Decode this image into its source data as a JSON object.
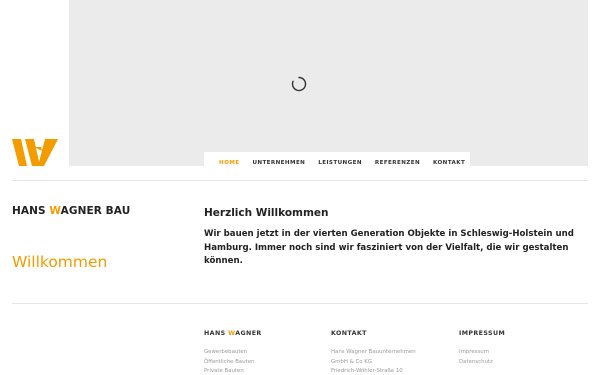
{
  "colors": {
    "accent": "#f39c00",
    "hero_bg": "#ebebeb",
    "text": "#222222",
    "muted": "#9a9a9a"
  },
  "logo": {
    "icon": "w-logo-icon"
  },
  "hero": {
    "icon": "loading-spinner-icon"
  },
  "nav": {
    "items": [
      {
        "label": "HOME",
        "active": true
      },
      {
        "label": "UNTERNEHMEN",
        "active": false
      },
      {
        "label": "LEISTUNGEN",
        "active": false
      },
      {
        "label": "REFERENZEN",
        "active": false
      },
      {
        "label": "KONTAKT",
        "active": false
      }
    ]
  },
  "brand": {
    "part1": "HANS ",
    "w": "W",
    "part2": "AGNER BAU"
  },
  "page_title": "Willkommen",
  "welcome": {
    "heading": "Herzlich Willkommen",
    "text": "Wir bauen jetzt in der vierten Generation Objekte in Schleswig-Holstein und Hamburg. Immer noch sind wir fasziniert von der Vielfalt, die wir gestalten können."
  },
  "footer": {
    "col1": {
      "heading_part1": "HANS ",
      "heading_w": "W",
      "heading_part2": "AGNER",
      "links": [
        "Gewerbebauten",
        "Öffentliche Bauten",
        "Private Bauten"
      ]
    },
    "col2": {
      "heading": "KONTAKT",
      "lines": [
        "Hans Wagner Bauunternehmen",
        "GmbH & Co KG",
        "Friedrich-Wöhler-Straße 10"
      ]
    },
    "col3": {
      "heading": "IMPRESSUM",
      "links": [
        "Impressum",
        "Datenschutz"
      ]
    }
  }
}
